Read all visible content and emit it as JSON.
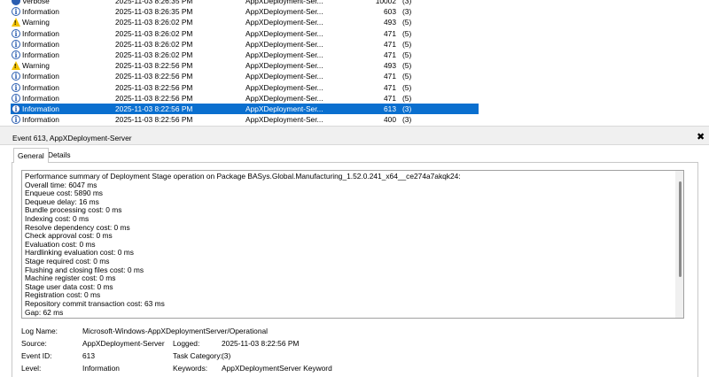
{
  "event_list": {
    "rows": [
      {
        "level": "Verbose",
        "icon": "verbose-icon",
        "date": "2025-11-03 8:26:35 PM",
        "source": "AppXDeployment-Ser...",
        "event_id": "10002",
        "task": "(3)",
        "selected": false
      },
      {
        "level": "Information",
        "icon": "info-icon",
        "date": "2025-11-03 8:26:35 PM",
        "source": "AppXDeployment-Ser...",
        "event_id": "603",
        "task": "(3)",
        "selected": false
      },
      {
        "level": "Warning",
        "icon": "warning-icon",
        "date": "2025-11-03 8:26:02 PM",
        "source": "AppXDeployment-Ser...",
        "event_id": "493",
        "task": "(5)",
        "selected": false
      },
      {
        "level": "Information",
        "icon": "info-icon",
        "date": "2025-11-03 8:26:02 PM",
        "source": "AppXDeployment-Ser...",
        "event_id": "471",
        "task": "(5)",
        "selected": false
      },
      {
        "level": "Information",
        "icon": "info-icon",
        "date": "2025-11-03 8:26:02 PM",
        "source": "AppXDeployment-Ser...",
        "event_id": "471",
        "task": "(5)",
        "selected": false
      },
      {
        "level": "Information",
        "icon": "info-icon",
        "date": "2025-11-03 8:26:02 PM",
        "source": "AppXDeployment-Ser...",
        "event_id": "471",
        "task": "(5)",
        "selected": false
      },
      {
        "level": "Warning",
        "icon": "warning-icon",
        "date": "2025-11-03 8:22:56 PM",
        "source": "AppXDeployment-Ser...",
        "event_id": "493",
        "task": "(5)",
        "selected": false
      },
      {
        "level": "Information",
        "icon": "info-icon",
        "date": "2025-11-03 8:22:56 PM",
        "source": "AppXDeployment-Ser...",
        "event_id": "471",
        "task": "(5)",
        "selected": false
      },
      {
        "level": "Information",
        "icon": "info-icon",
        "date": "2025-11-03 8:22:56 PM",
        "source": "AppXDeployment-Ser...",
        "event_id": "471",
        "task": "(5)",
        "selected": false
      },
      {
        "level": "Information",
        "icon": "info-icon",
        "date": "2025-11-03 8:22:56 PM",
        "source": "AppXDeployment-Ser...",
        "event_id": "471",
        "task": "(5)",
        "selected": false
      },
      {
        "level": "Information",
        "icon": "info-icon",
        "date": "2025-11-03 8:22:56 PM",
        "source": "AppXDeployment-Ser...",
        "event_id": "613",
        "task": "(3)",
        "selected": true
      },
      {
        "level": "Information",
        "icon": "info-icon",
        "date": "2025-11-03 8:22:56 PM",
        "source": "AppXDeployment-Ser...",
        "event_id": "400",
        "task": "(3)",
        "selected": false
      }
    ],
    "selection_color": "#0a6fcf"
  },
  "detail": {
    "title": "Event 613, AppXDeployment-Server",
    "close_glyph": "✖",
    "tabs": [
      {
        "label": "General",
        "active": true
      },
      {
        "label": "Details",
        "active": false
      }
    ],
    "description_lines": [
      "Performance summary of Deployment Stage operation on Package BASys.Global.Manufacturing_1.52.0.241_x64__ce274a7akqk24:",
      "Overall time: 6047 ms",
      "Enqueue cost: 5890 ms",
      "Dequeue delay: 16 ms",
      "Bundle processing cost: 0 ms",
      "Indexing cost: 0 ms",
      "Resolve dependency cost: 0 ms",
      "Check approval cost: 0 ms",
      "Evaluation cost: 0 ms",
      "Hardlinking evaluation cost: 0 ms",
      "Stage required cost: 0 ms",
      "Flushing and closing files cost: 0 ms",
      "Machine register cost: 0 ms",
      "Stage user data cost: 0 ms",
      "Registration cost: 0 ms",
      "Repository commit transaction cost: 63 ms",
      "Gap: 62 ms"
    ],
    "properties": {
      "log_name_label": "Log Name:",
      "log_name": "Microsoft-Windows-AppXDeploymentServer/Operational",
      "source_label": "Source:",
      "source": "AppXDeployment-Server",
      "logged_label": "Logged:",
      "logged": "2025-11-03 8:22:56 PM",
      "event_id_label": "Event ID:",
      "event_id": "613",
      "task_category_label": "Task Category:",
      "task_category": "(3)",
      "level_label": "Level:",
      "level": "Information",
      "keywords_label": "Keywords:",
      "keywords": "AppXDeploymentServer Keyword"
    }
  }
}
